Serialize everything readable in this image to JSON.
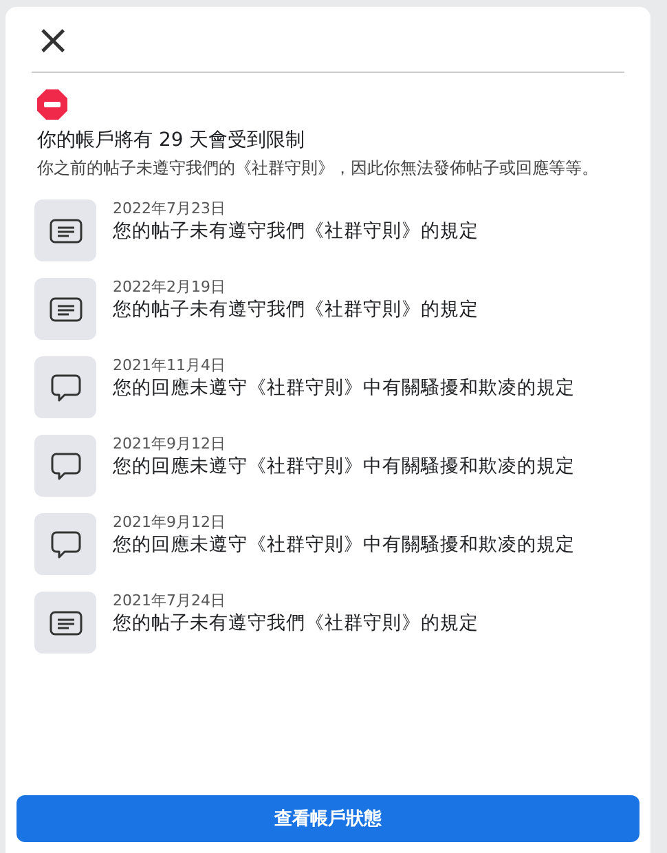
{
  "dialog": {
    "close_icon": "×",
    "title": "你的帳戶將有 29 天會受到限制",
    "description": "你之前的帖子未遵守我們的《社群守則》，因此你無法發佈帖子或回應等等。"
  },
  "violations": [
    {
      "kind": "post",
      "date": "2022年7月23日",
      "text": "您的帖子未有遵守我們《社群守則》的規定"
    },
    {
      "kind": "post",
      "date": "2022年2月19日",
      "text": "您的帖子未有遵守我們《社群守則》的規定"
    },
    {
      "kind": "comment",
      "date": "2021年11月4日",
      "text": "您的回應未遵守《社群守則》中有關騷擾和欺凌的規定"
    },
    {
      "kind": "comment",
      "date": "2021年9月12日",
      "text": "您的回應未遵守《社群守則》中有關騷擾和欺凌的規定"
    },
    {
      "kind": "comment",
      "date": "2021年9月12日",
      "text": "您的回應未遵守《社群守則》中有關騷擾和欺凌的規定"
    },
    {
      "kind": "post",
      "date": "2021年7月24日",
      "text": "您的帖子未有遵守我們《社群守則》的規定"
    }
  ],
  "button": {
    "label": "查看帳戶狀態"
  }
}
